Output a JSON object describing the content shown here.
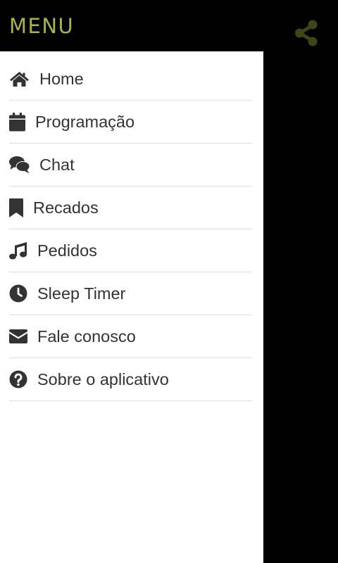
{
  "header": {
    "title": "MENU",
    "title_color": "#a8b34a",
    "share_icon": "share-icon",
    "share_icon_color": "#3f4514"
  },
  "menu": {
    "items": [
      {
        "label": "Home",
        "icon": "home-icon"
      },
      {
        "label": "Programação",
        "icon": "calendar-icon"
      },
      {
        "label": "Chat",
        "icon": "chat-icon"
      },
      {
        "label": "Recados",
        "icon": "bookmark-icon"
      },
      {
        "label": "Pedidos",
        "icon": "music-note-icon"
      },
      {
        "label": "Sleep Timer",
        "icon": "clock-icon"
      },
      {
        "label": "Fale conosco",
        "icon": "envelope-icon"
      },
      {
        "label": "Sobre o aplicativo",
        "icon": "question-circle-icon"
      }
    ]
  },
  "colors": {
    "drawer_background": "#ffffff",
    "backdrop": "#000000",
    "text": "#333333",
    "divider": "#dddddd"
  }
}
